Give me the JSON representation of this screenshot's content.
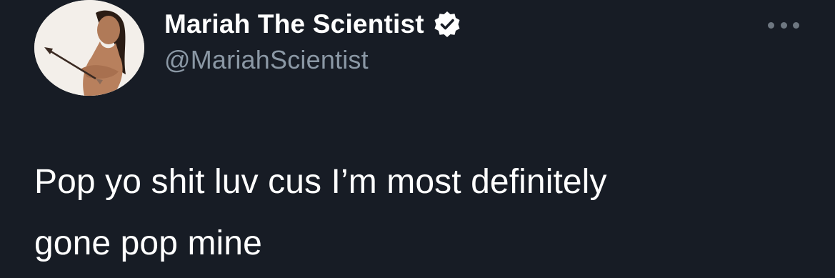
{
  "tweet": {
    "author": {
      "display_name": "Mariah The Scientist",
      "handle": "@MariahScientist",
      "verified": true,
      "avatar_icon": "profile-photo"
    },
    "more_icon": "ellipsis-icon",
    "text_line_1": "Pop yo shit luv cus I’m most definitely",
    "text_line_2": "gone pop mine"
  },
  "colors": {
    "background": "#171c25",
    "text": "#ffffff",
    "secondary_text": "#8b98a5",
    "verified_badge": "#ffffff"
  }
}
